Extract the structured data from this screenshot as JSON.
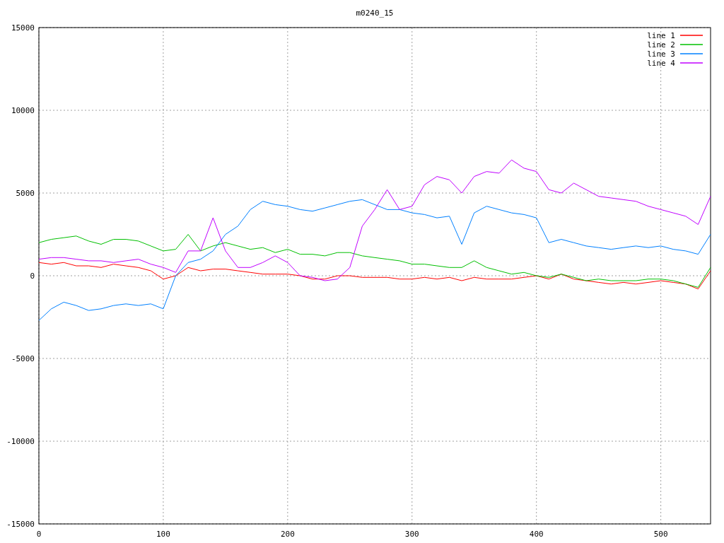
{
  "chart_data": {
    "type": "line",
    "title": "m0240_15",
    "x": [
      0,
      10,
      20,
      30,
      40,
      50,
      60,
      70,
      80,
      90,
      100,
      110,
      120,
      130,
      140,
      150,
      160,
      170,
      180,
      190,
      200,
      210,
      220,
      230,
      240,
      250,
      260,
      270,
      280,
      290,
      300,
      310,
      320,
      330,
      340,
      350,
      360,
      370,
      380,
      390,
      400,
      410,
      420,
      430,
      440,
      450,
      460,
      470,
      480,
      490,
      500,
      510,
      520,
      530,
      540
    ],
    "xlim": [
      0,
      540
    ],
    "ylim": [
      -15000,
      15000
    ],
    "xticks": [
      0,
      100,
      200,
      300,
      400,
      500
    ],
    "yticks": [
      -15000,
      -10000,
      -5000,
      0,
      5000,
      10000,
      15000
    ],
    "grid": true,
    "legend": true,
    "series": [
      {
        "name": "line 1",
        "color": "#ff0000",
        "values": [
          800,
          700,
          800,
          600,
          600,
          500,
          700,
          600,
          500,
          300,
          -200,
          0,
          500,
          300,
          400,
          400,
          300,
          200,
          100,
          100,
          100,
          0,
          -200,
          -200,
          0,
          0,
          -100,
          -100,
          -100,
          -200,
          -200,
          -100,
          -200,
          -100,
          -300,
          -100,
          -200,
          -200,
          -200,
          -100,
          0,
          -200,
          100,
          -200,
          -300,
          -400,
          -500,
          -400,
          -500,
          -400,
          -300,
          -400,
          -500,
          -800,
          300
        ]
      },
      {
        "name": "line 2",
        "color": "#00c000",
        "values": [
          2000,
          2200,
          2300,
          2400,
          2100,
          1900,
          2200,
          2200,
          2100,
          1800,
          1500,
          1600,
          2500,
          1500,
          1800,
          2000,
          1800,
          1600,
          1700,
          1400,
          1600,
          1300,
          1300,
          1200,
          1400,
          1400,
          1200,
          1100,
          1000,
          900,
          700,
          700,
          600,
          500,
          500,
          900,
          500,
          300,
          100,
          200,
          0,
          -100,
          100,
          -100,
          -300,
          -200,
          -300,
          -300,
          -300,
          -200,
          -200,
          -300,
          -500,
          -700,
          500
        ]
      },
      {
        "name": "line 3",
        "color": "#0080ff",
        "values": [
          -2700,
          -2000,
          -1600,
          -1800,
          -2100,
          -2000,
          -1800,
          -1700,
          -1800,
          -1700,
          -2000,
          0,
          800,
          1000,
          1500,
          2500,
          3000,
          4000,
          4500,
          4300,
          4200,
          4000,
          3900,
          4100,
          4300,
          4500,
          4600,
          4300,
          4000,
          4000,
          3800,
          3700,
          3500,
          3600,
          1900,
          3800,
          4200,
          4000,
          3800,
          3700,
          3500,
          2000,
          2200,
          2000,
          1800,
          1700,
          1600,
          1700,
          1800,
          1700,
          1800,
          1600,
          1500,
          1300,
          2500
        ]
      },
      {
        "name": "line 4",
        "color": "#c000ff",
        "values": [
          1000,
          1100,
          1100,
          1000,
          900,
          900,
          800,
          900,
          1000,
          700,
          500,
          200,
          1500,
          1500,
          3500,
          1500,
          500,
          500,
          800,
          1200,
          800,
          0,
          -100,
          -300,
          -200,
          500,
          3000,
          4000,
          5200,
          4000,
          4200,
          5500,
          6000,
          5800,
          5000,
          6000,
          6300,
          6200,
          7000,
          6500,
          6300,
          5200,
          5000,
          5600,
          5200,
          4800,
          4700,
          4600,
          4500,
          4200,
          4000,
          3800,
          3600,
          3100,
          4800
        ]
      }
    ]
  }
}
